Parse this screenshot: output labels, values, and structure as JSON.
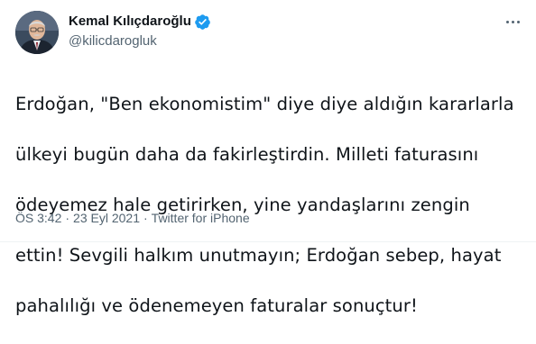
{
  "author": {
    "display_name": "Kemal Kılıçdaroğlu",
    "handle": "@kilicdarogluk",
    "verified": true,
    "avatar_icon": "profile-photo"
  },
  "tweet": {
    "lines": [
      "Erdoğan, \"Ben ekonomistim\" diye diye aldığın kararlarla",
      "ülkeyi bugün daha da fakirleştirdin. Milleti faturasını",
      "ödeyemez hale getirirken, yine yandaşlarını zengin",
      "ettin! Sevgili halkım unutmayın; Erdoğan sebep, hayat",
      "pahalılığı ve ödenemeyen faturalar sonuçtur!"
    ]
  },
  "meta": {
    "time": "ÖS 3:42",
    "separator": "·",
    "date": "23 Eyl 2021",
    "source": "Twitter for iPhone"
  },
  "colors": {
    "text": "#0f1419",
    "secondary": "#536471",
    "verified": "#1d9bf0"
  },
  "icons": {
    "verified": "verified-badge-icon",
    "more": "more-options-icon"
  }
}
